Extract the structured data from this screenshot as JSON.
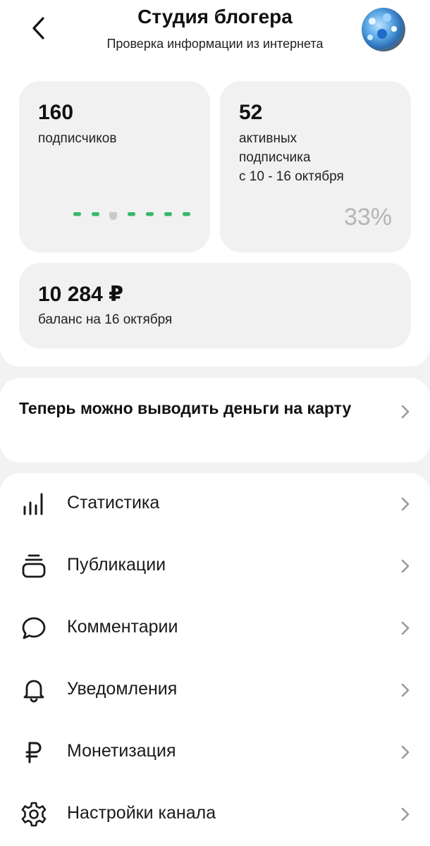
{
  "header": {
    "title": "Студия блогера",
    "subtitle": "Проверка информации из интернета"
  },
  "stats": {
    "subscribers": {
      "value": "160",
      "label": "подписчиков"
    },
    "active": {
      "value": "52",
      "label_line1": "активных",
      "label_line2": "подписчика",
      "label_line3": "с 10 - 16 октября",
      "percent": "33%"
    },
    "balance": {
      "value": "10 284 ₽",
      "label": "баланс на 16 октября"
    }
  },
  "promo": {
    "text": "Теперь можно выводить деньги на карту"
  },
  "menu": {
    "items": [
      {
        "label": "Статистика",
        "icon": "chart-bars-icon"
      },
      {
        "label": "Публикации",
        "icon": "publications-stack-icon"
      },
      {
        "label": "Комментарии",
        "icon": "comment-bubble-icon"
      },
      {
        "label": "Уведомления",
        "icon": "bell-icon"
      },
      {
        "label": "Монетизация",
        "icon": "ruble-icon"
      },
      {
        "label": "Настройки канала",
        "icon": "gear-icon"
      }
    ]
  },
  "colors": {
    "accent_green": "#35b86a",
    "card_bg": "#f1f1f1",
    "page_bg": "#f2f2f2",
    "percent_gray": "#b5b5b5"
  }
}
